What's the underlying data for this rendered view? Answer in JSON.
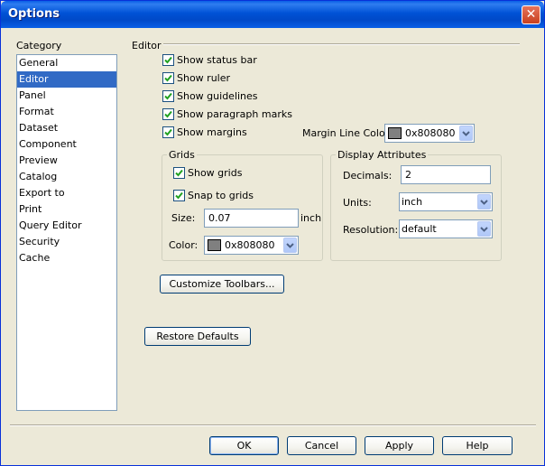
{
  "window": {
    "title": "Options"
  },
  "category": {
    "heading": "Category",
    "items": [
      "General",
      "Editor",
      "Panel",
      "Format",
      "Dataset",
      "Component",
      "Preview",
      "Catalog",
      "Export to",
      "Print",
      "Query Editor",
      "Security",
      "Cache"
    ],
    "selected": "Editor"
  },
  "editor": {
    "heading": "Editor",
    "checkboxes": [
      {
        "label": "Show status bar",
        "checked": true
      },
      {
        "label": "Show ruler",
        "checked": true
      },
      {
        "label": "Show guidelines",
        "checked": true
      },
      {
        "label": "Show paragraph marks",
        "checked": true
      },
      {
        "label": "Show margins",
        "checked": true
      }
    ],
    "margin_line_color": {
      "label": "Margin Line Color:",
      "value": "0x808080",
      "swatch": "#808080"
    }
  },
  "grids": {
    "title": "Grids",
    "show_grids": {
      "label": "Show grids",
      "checked": true
    },
    "snap_to_grids": {
      "label": "Snap to grids",
      "checked": true
    },
    "size": {
      "label": "Size:",
      "value": "0.07",
      "unit": "inch"
    },
    "color": {
      "label": "Color:",
      "value": "0x808080",
      "swatch": "#808080"
    }
  },
  "display": {
    "title": "Display Attributes",
    "decimals": {
      "label": "Decimals:",
      "value": "2"
    },
    "units": {
      "label": "Units:",
      "value": "inch"
    },
    "resolution": {
      "label": "Resolution:",
      "value": "default"
    }
  },
  "buttons": {
    "customize_toolbars": "Customize Toolbars...",
    "restore_defaults": "Restore Defaults",
    "ok": "OK",
    "cancel": "Cancel",
    "apply": "Apply",
    "help": "Help"
  },
  "colors": {
    "title_bar": "#0054e3",
    "selection": "#316ac5",
    "check": "#21a121",
    "dialog_bg": "#ece9d8"
  }
}
